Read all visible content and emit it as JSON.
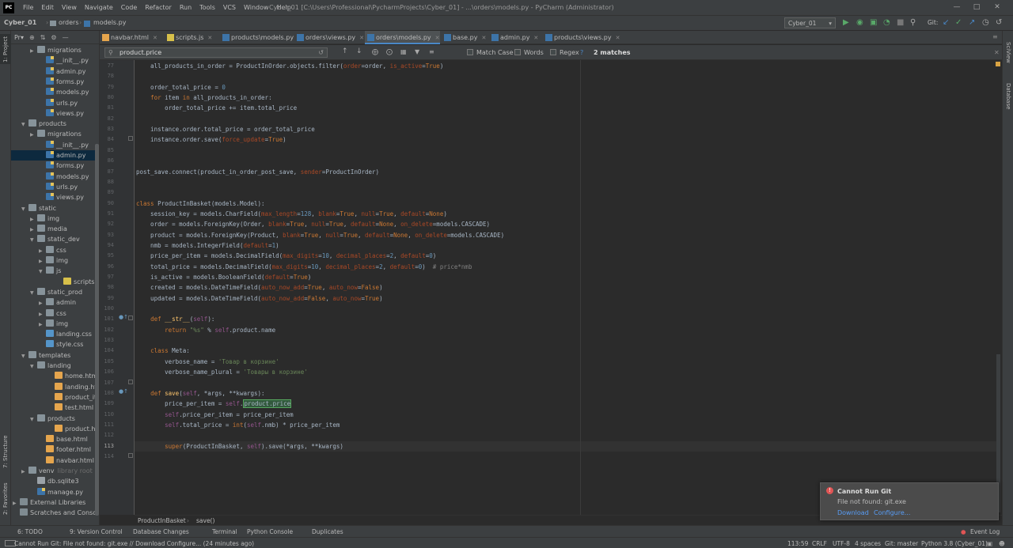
{
  "app": {
    "logo": "PC",
    "menu": [
      "File",
      "Edit",
      "View",
      "Navigate",
      "Code",
      "Refactor",
      "Run",
      "Tools",
      "VCS",
      "Window",
      "Help"
    ],
    "window_title": "Cyber_01 [C:\\Users\\Professional\\PycharmProjects\\Cyber_01] - ...\\orders\\models.py - PyCharm (Administrator)"
  },
  "navbar": {
    "breadcrumbs": [
      "Cyber_01",
      "orders",
      "models.py"
    ],
    "run_config": "Cyber_01",
    "git_label": "Git:"
  },
  "sidebar": {
    "left_labels": [
      "1: Project",
      "7: Structure",
      "2: Favorites"
    ],
    "right_labels": [
      "SciView",
      "Database"
    ]
  },
  "project": {
    "header": "Pr▾",
    "tree": [
      {
        "label": "migrations",
        "type": "folder",
        "depth": 2,
        "arrow": "▶"
      },
      {
        "label": "__init__.py",
        "type": "py",
        "depth": 3
      },
      {
        "label": "admin.py",
        "type": "py",
        "depth": 3
      },
      {
        "label": "forms.py",
        "type": "py",
        "depth": 3
      },
      {
        "label": "models.py",
        "type": "py",
        "depth": 3
      },
      {
        "label": "urls.py",
        "type": "py",
        "depth": 3
      },
      {
        "label": "views.py",
        "type": "py",
        "depth": 3
      },
      {
        "label": "products",
        "type": "folder",
        "depth": 1,
        "arrow": "▼"
      },
      {
        "label": "migrations",
        "type": "folder",
        "depth": 2,
        "arrow": "▶"
      },
      {
        "label": "__init__.py",
        "type": "py",
        "depth": 3
      },
      {
        "label": "admin.py",
        "type": "py",
        "depth": 3,
        "selected": true
      },
      {
        "label": "forms.py",
        "type": "py",
        "depth": 3
      },
      {
        "label": "models.py",
        "type": "py",
        "depth": 3
      },
      {
        "label": "urls.py",
        "type": "py",
        "depth": 3
      },
      {
        "label": "views.py",
        "type": "py",
        "depth": 3
      },
      {
        "label": "static",
        "type": "folder",
        "depth": 1,
        "arrow": "▼"
      },
      {
        "label": "img",
        "type": "folder",
        "depth": 2,
        "arrow": "▶"
      },
      {
        "label": "media",
        "type": "folder",
        "depth": 2,
        "arrow": "▶"
      },
      {
        "label": "static_dev",
        "type": "folder",
        "depth": 2,
        "arrow": "▼"
      },
      {
        "label": "css",
        "type": "folder",
        "depth": 3,
        "arrow": "▶"
      },
      {
        "label": "img",
        "type": "folder",
        "depth": 3,
        "arrow": "▶"
      },
      {
        "label": "js",
        "type": "folder",
        "depth": 3,
        "arrow": "▼"
      },
      {
        "label": "scripts.js",
        "type": "js",
        "depth": 5
      },
      {
        "label": "static_prod",
        "type": "folder",
        "depth": 2,
        "arrow": "▼"
      },
      {
        "label": "admin",
        "type": "folder",
        "depth": 3,
        "arrow": "▶"
      },
      {
        "label": "css",
        "type": "folder",
        "depth": 3,
        "arrow": "▶"
      },
      {
        "label": "img",
        "type": "folder",
        "depth": 3,
        "arrow": "▶"
      },
      {
        "label": "landing.css",
        "type": "css",
        "depth": 3
      },
      {
        "label": "style.css",
        "type": "css",
        "depth": 3
      },
      {
        "label": "templates",
        "type": "folder",
        "depth": 1,
        "arrow": "▼"
      },
      {
        "label": "landing",
        "type": "folder",
        "depth": 2,
        "arrow": "▼"
      },
      {
        "label": "home.html",
        "type": "html",
        "depth": 4
      },
      {
        "label": "landing.html",
        "type": "html",
        "depth": 4
      },
      {
        "label": "product_item",
        "type": "html",
        "depth": 4
      },
      {
        "label": "test.html",
        "type": "html",
        "depth": 4
      },
      {
        "label": "products",
        "type": "folder",
        "depth": 2,
        "arrow": "▼"
      },
      {
        "label": "product.html",
        "type": "html",
        "depth": 4
      },
      {
        "label": "base.html",
        "type": "html",
        "depth": 3
      },
      {
        "label": "footer.html",
        "type": "html",
        "depth": 3
      },
      {
        "label": "navbar.html",
        "type": "html",
        "depth": 3
      },
      {
        "label": "venv",
        "type": "folder",
        "depth": 1,
        "arrow": "▶",
        "suffix": "library root"
      },
      {
        "label": "db.sqlite3",
        "type": "db",
        "depth": 2
      },
      {
        "label": "manage.py",
        "type": "py",
        "depth": 2
      },
      {
        "label": "External Libraries",
        "type": "lib",
        "depth": 0,
        "arrow": "▶"
      },
      {
        "label": "Scratches and Consoles",
        "type": "lib",
        "depth": 0
      }
    ]
  },
  "tabs": [
    {
      "label": "navbar.html",
      "type": "html"
    },
    {
      "label": "scripts.js",
      "type": "js"
    },
    {
      "label": "products\\models.py",
      "type": "py"
    },
    {
      "label": "orders\\views.py",
      "type": "py"
    },
    {
      "label": "orders\\models.py",
      "type": "py",
      "active": true
    },
    {
      "label": "base.py",
      "type": "py"
    },
    {
      "label": "admin.py",
      "type": "py"
    },
    {
      "label": "products\\views.py",
      "type": "py"
    }
  ],
  "find": {
    "query": "product.price",
    "match_case": "Match Case",
    "words": "Words",
    "regex": "Regex",
    "help": "?",
    "matches": "2 matches"
  },
  "editor": {
    "lines": [
      {
        "n": "77",
        "h": "    all_products_in_order = ProductInOrder.objects.filter(<span class=par>order</span>=order, <span class=par>is_active</span>=<span class=kw>True</span>)"
      },
      {
        "n": "78",
        "h": ""
      },
      {
        "n": "79",
        "h": "    order_total_price = <span class=num>0</span>"
      },
      {
        "n": "80",
        "h": "    <span class=kw>for</span> item <span class=kw>in</span> all_products_in_order:"
      },
      {
        "n": "81",
        "h": "        order_total_price += item.total_price"
      },
      {
        "n": "82",
        "h": ""
      },
      {
        "n": "83",
        "h": "    instance.order.total_price = order_total_price"
      },
      {
        "n": "84",
        "h": "    instance.order.save(<span class=par>force_update</span>=<span class=kw>True</span>)"
      },
      {
        "n": "85",
        "h": ""
      },
      {
        "n": "86",
        "h": ""
      },
      {
        "n": "87",
        "h": "post_save.connect(product_in_order_post_save, <span class=par>sender</span>=ProductInOrder)"
      },
      {
        "n": "88",
        "h": ""
      },
      {
        "n": "89",
        "h": ""
      },
      {
        "n": "90",
        "h": "<span class=kw>class</span> ProductInBasket(models.Model):"
      },
      {
        "n": "91",
        "h": "    session_key = models.CharField(<span class=par>max_length</span>=<span class=num>128</span>, <span class=par>blank</span>=<span class=kw>True</span>, <span class=par>null</span>=<span class=kw>True</span>, <span class=par>default</span>=<span class=kw>None</span>)"
      },
      {
        "n": "92",
        "h": "    order = models.ForeignKey(Order, <span class=par>blank</span>=<span class=kw>True</span>, <span class=par>null</span>=<span class=kw>True</span>, <span class=par>default</span>=<span class=kw>None</span>, <span class=par>on_delete</span>=models.CASCADE)"
      },
      {
        "n": "93",
        "h": "    product = models.ForeignKey(Product, <span class=par>blank</span>=<span class=kw>True</span>, <span class=par>null</span>=<span class=kw>True</span>, <span class=par>default</span>=<span class=kw>None</span>, <span class=par>on_delete</span>=models.CASCADE)"
      },
      {
        "n": "94",
        "h": "    nmb = models.IntegerField(<span class=par>default</span>=<span class=num>1</span>)"
      },
      {
        "n": "95",
        "h": "    price_per_item = models.DecimalField(<span class=par>max_digits</span>=<span class=num>10</span>, <span class=par>decimal_places</span>=<span class=num>2</span>, <span class=par>default</span>=<span class=num>0</span>)"
      },
      {
        "n": "96",
        "h": "    total_price = models.DecimalField(<span class=par>max_digits</span>=<span class=num>10</span>, <span class=par>decimal_places</span>=<span class=num>2</span>, <span class=par>default</span>=<span class=num>0</span>)  <span class=cmt># price*nmb</span>"
      },
      {
        "n": "97",
        "h": "    is_active = models.BooleanField(<span class=par>default</span>=<span class=kw>True</span>)"
      },
      {
        "n": "98",
        "h": "    created = models.DateTimeField(<span class=par>auto_now_add</span>=<span class=kw>True</span>, <span class=par>auto_now</span>=<span class=kw>False</span>)"
      },
      {
        "n": "99",
        "h": "    updated = models.DateTimeField(<span class=par>auto_now_add</span>=<span class=kw>False</span>, <span class=par>auto_now</span>=<span class=kw>True</span>)"
      },
      {
        "n": "100",
        "h": ""
      },
      {
        "n": "101",
        "h": "    <span class=kw>def</span> <span class=fn>__str__</span>(<span class=slf>self</span>):"
      },
      {
        "n": "102",
        "h": "        <span class=kw>return</span> <span class=str>\"%s\"</span> % <span class=slf>self</span>.product.name"
      },
      {
        "n": "103",
        "h": ""
      },
      {
        "n": "104",
        "h": "    <span class=kw>class</span> Meta:"
      },
      {
        "n": "105",
        "h": "        verbose_name = <span class=str>'Товар в корзине'</span>"
      },
      {
        "n": "106",
        "h": "        verbose_name_plural = <span class=str>'Товары в корзине'</span>"
      },
      {
        "n": "107",
        "h": ""
      },
      {
        "n": "108",
        "h": "    <span class=kw>def</span> <span class=fn>save</span>(<span class=slf>self</span>, *args, **kwargs):"
      },
      {
        "n": "109",
        "h": "        price_per_item = <span class=slf>self</span>.<span class=match>product.price</span>"
      },
      {
        "n": "110",
        "h": "        <span class=slf>self</span>.price_per_item = price_per_item"
      },
      {
        "n": "111",
        "h": "        <span class=slf>self</span>.total_price = <span class=kw>int</span>(<span class=slf>self</span>.nmb) * price_per_item"
      },
      {
        "n": "112",
        "h": ""
      },
      {
        "n": "113",
        "h": "        <span class=kw>super</span>(ProductInBasket, <span class=slf>self</span>).save(*args, **kwargs)",
        "current": true
      },
      {
        "n": "114",
        "h": ""
      }
    ],
    "breadcrumb": [
      "ProductInBasket",
      "save()"
    ]
  },
  "toolwindows": [
    "6: TODO",
    "9: Version Control",
    "Database Changes",
    "Terminal",
    "Python Console",
    "Duplicates"
  ],
  "event_log": "Event Log",
  "notification": {
    "title": "Cannot Run Git",
    "body": "File not found: git.exe",
    "download": "Download",
    "configure": "Configure..."
  },
  "status": {
    "message": "Cannot Run Git: File not found: git.exe // Download   Configure... (24 minutes ago)",
    "position": "113:59",
    "line_sep": "CRLF",
    "encoding": "UTF-8",
    "indent": "4 spaces",
    "git": "Git: master",
    "interpreter": "Python 3.8 (Cyber_01)"
  },
  "colors": {
    "background": "#2b2b2b",
    "panel": "#3c3f41",
    "keyword": "#cc7832",
    "string": "#6a8759",
    "number": "#6897bb",
    "accent": "#4a88c7"
  }
}
